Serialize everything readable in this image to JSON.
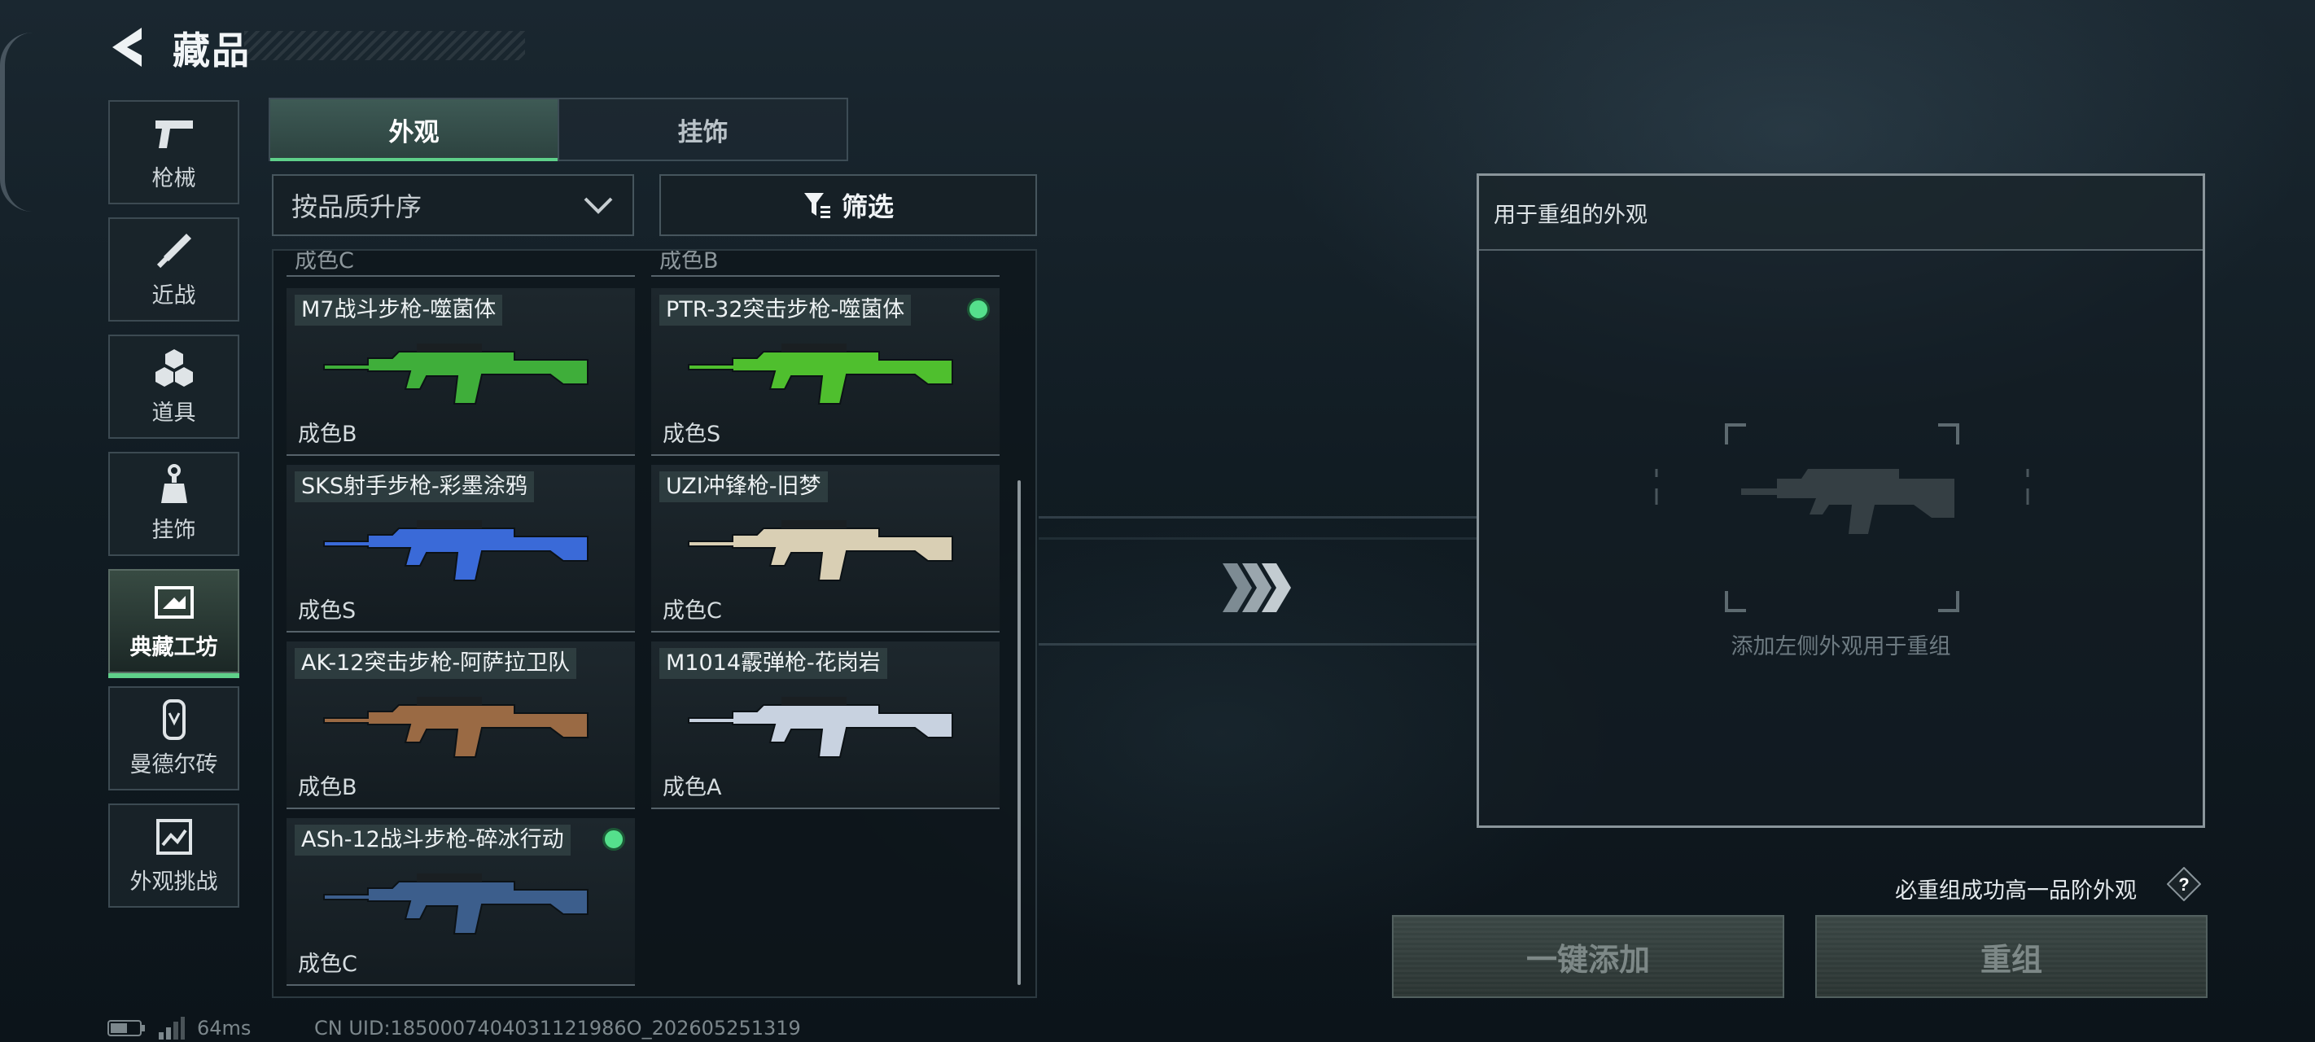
{
  "header": {
    "title": "藏品"
  },
  "sidebar": {
    "items": [
      {
        "label": "枪械",
        "icon": "pistol-icon",
        "active": false
      },
      {
        "label": "近战",
        "icon": "knife-icon",
        "active": false
      },
      {
        "label": "道具",
        "icon": "cubes-icon",
        "active": false
      },
      {
        "label": "挂饰",
        "icon": "charm-icon",
        "active": false
      },
      {
        "label": "典藏工坊",
        "icon": "workshop-icon",
        "active": true
      },
      {
        "label": "曼德尔砖",
        "icon": "brick-icon",
        "active": false
      },
      {
        "label": "外观挑战",
        "icon": "challenge-icon",
        "active": false
      }
    ]
  },
  "tabs": [
    {
      "label": "外观",
      "active": true
    },
    {
      "label": "挂饰",
      "active": false
    }
  ],
  "controls": {
    "sort_label": "按品质升序",
    "filter_label": "筛选"
  },
  "list": {
    "partial_top": [
      "成色C",
      "成色B"
    ],
    "items": [
      {
        "name": "M7战斗步枪-噬菌体",
        "grade": "成色B",
        "selected": false,
        "accent": "#3fae3a"
      },
      {
        "name": "PTR-32突击步枪-噬菌体",
        "grade": "成色S",
        "selected": true,
        "accent": "#4fbf2e"
      },
      {
        "name": "SKS射手步枪-彩墨涂鸦",
        "grade": "成色S",
        "selected": false,
        "accent": "#3a6ad8"
      },
      {
        "name": "UZI冲锋枪-旧梦",
        "grade": "成色C",
        "selected": false,
        "accent": "#d9cfb4"
      },
      {
        "name": "AK-12突击步枪-阿萨拉卫队",
        "grade": "成色B",
        "selected": false,
        "accent": "#9a6a44"
      },
      {
        "name": "M1014霰弹枪-花岗岩",
        "grade": "成色A",
        "selected": false,
        "accent": "#c8d2e0"
      },
      {
        "name": "ASh-12战斗步枪-碎冰行动",
        "grade": "成色C",
        "selected": true,
        "accent": "#3c5e8c"
      }
    ]
  },
  "recombine": {
    "title": "用于重组的外观",
    "hint": "添加左侧外观用于重组"
  },
  "footer": {
    "guarantee_text": "必重组成功高一品阶外观",
    "help_symbol": "?",
    "add_all_label": "一键添加",
    "recombine_label": "重组"
  },
  "status": {
    "ping": "64ms",
    "uid": "CN UID:1850007404031121986O_202605251319"
  }
}
